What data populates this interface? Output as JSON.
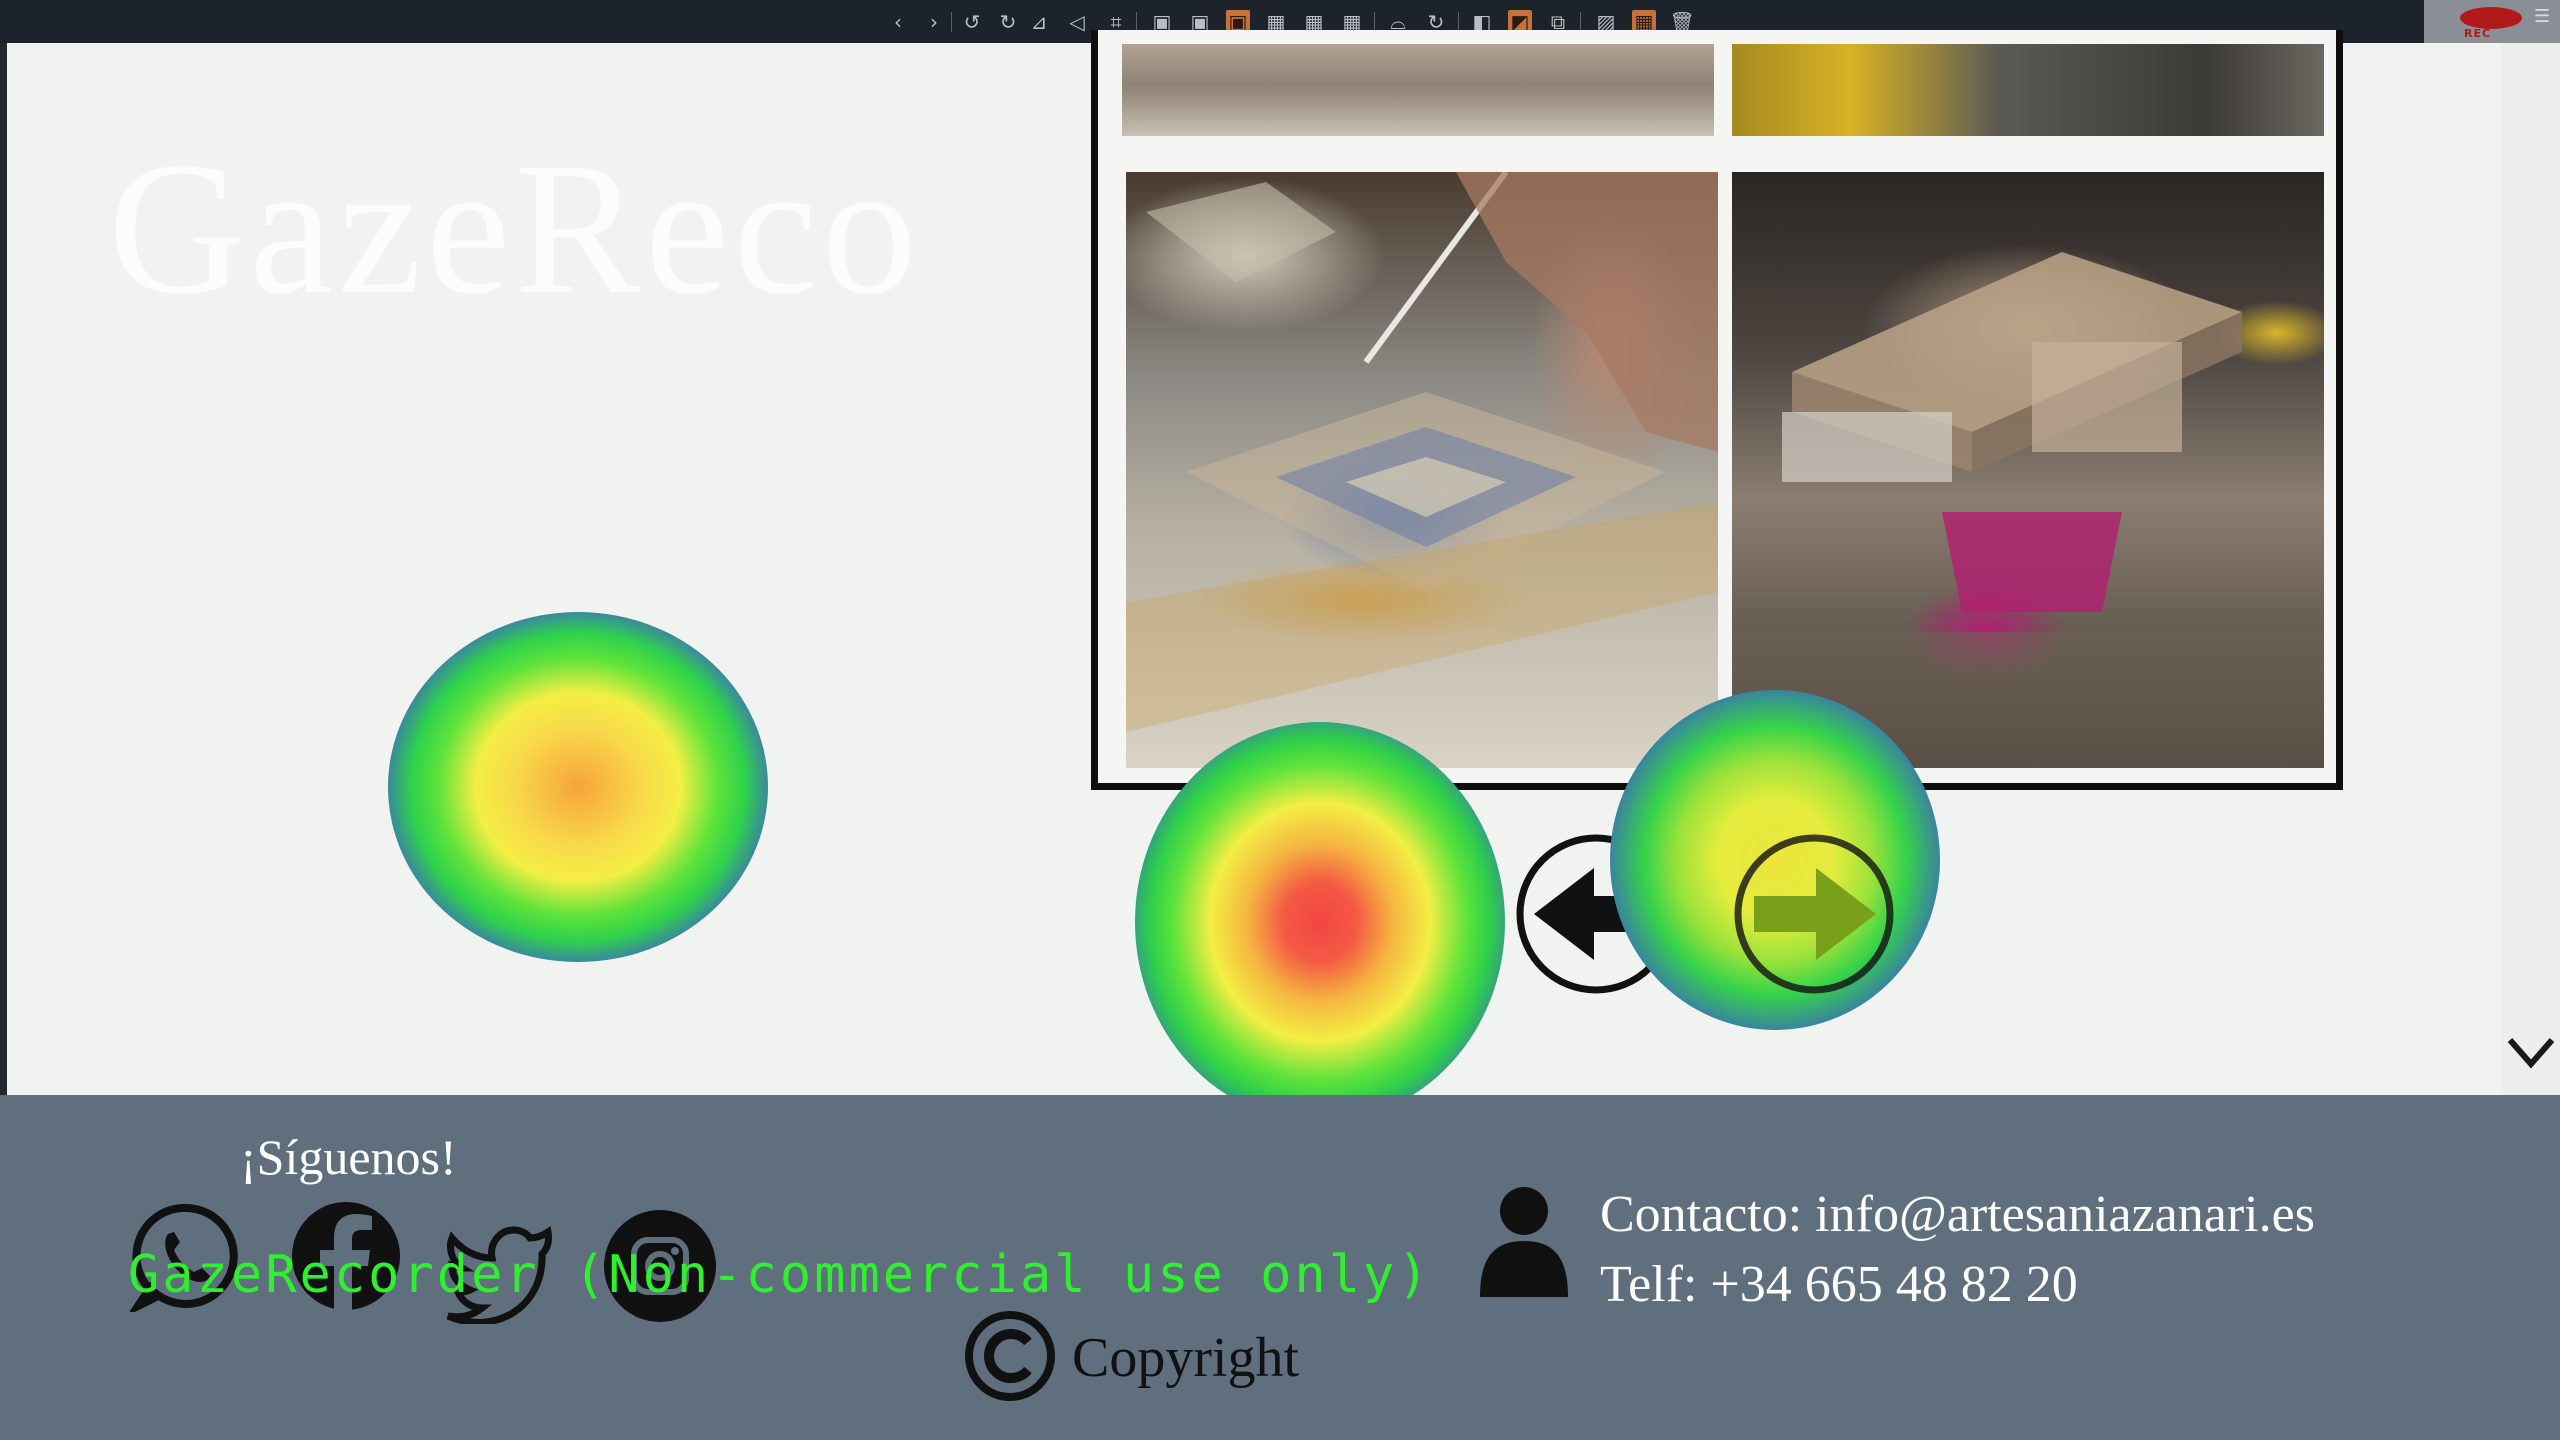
{
  "toolbar": {
    "tools": [
      "chevron-left-icon",
      "chevron-right-icon",
      "rotate-left-icon",
      "rotate-right-icon",
      "flip-horizontal-icon",
      "flip-vertical-icon",
      "crop-icon",
      "frame-1-icon",
      "frame-2-icon",
      "frame-3-icon",
      "frame-4-icon",
      "frame-5-icon",
      "frame-6-icon",
      "undo-icon",
      "refresh-icon",
      "layout-1-icon",
      "layout-2-icon",
      "image-edit-icon",
      "image-icon",
      "grid-icon",
      "trash-icon"
    ],
    "rec_label": "REC"
  },
  "watermark": {
    "text": "GazeReco"
  },
  "gallery": {
    "photos": [
      "craft-photo-top-left",
      "craft-photo-top-right",
      "painted-tile-photo",
      "carved-block-photo"
    ]
  },
  "carousel": {
    "prev": "arrow-left-icon",
    "next": "arrow-right-icon"
  },
  "heatmap": {
    "palette": [
      "#f24444",
      "#f5b640",
      "#f3ee45",
      "#5fe33a",
      "#2ecf4a",
      "#3a7ea6"
    ]
  },
  "footer": {
    "follow_label": "¡Síguenos!",
    "social": [
      "whatsapp-icon",
      "facebook-icon",
      "twitter-icon",
      "instagram-icon"
    ],
    "gaze_overlay": "GazeRecorder (Non-commercial use only)",
    "contact_line": "Contacto: info@artesaniazanari.es",
    "phone_line": "Telf: +34 665 48 82 20",
    "copyright_label": "Copyright",
    "background": "#5f6f7e"
  }
}
